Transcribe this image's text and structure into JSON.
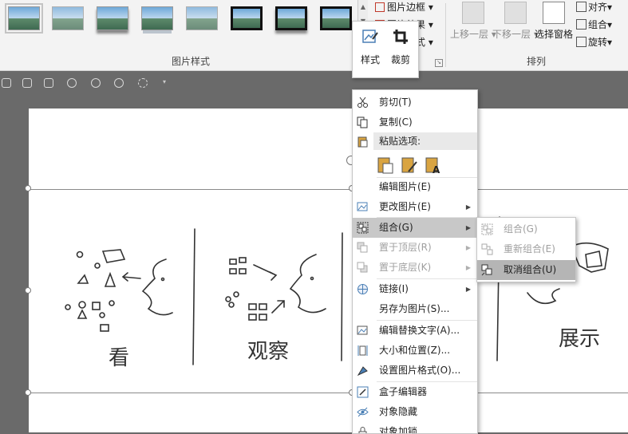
{
  "ribbon": {
    "gallery_styles": [
      "simple-frame-white",
      "soft-edge-rectangle",
      "drop-shadow-rectangle",
      "reflected-rounded",
      "soft-edge-oval",
      "double-frame-black",
      "thick-matte-black",
      "simple-frame-black"
    ],
    "picture_border": "图片边框",
    "picture_effects": "图片效果",
    "picture_layout": "图片版式",
    "picture_styles_group": "图片样式",
    "bring_forward": "上移一层",
    "send_backward": "下移一层",
    "selection_pane": "选择窗格",
    "align": "对齐",
    "group": "组合",
    "rotate": "旋转",
    "arrange_group": "排列"
  },
  "mini_toolbar": {
    "style": "样式",
    "crop": "裁剪"
  },
  "slide": {
    "label_see": "看",
    "label_observe": "观察",
    "label_show": "展示"
  },
  "context_menu": {
    "items": [
      {
        "label": "剪切(T)",
        "icon": "scissors-icon"
      },
      {
        "label": "复制(C)",
        "icon": "copy-icon"
      },
      {
        "label": "粘贴选项:",
        "icon": "clipboard-icon"
      },
      {
        "label": "编辑图片(E)"
      },
      {
        "label": "更改图片(E)",
        "icon": "change-picture-icon"
      },
      {
        "label": "组合(G)",
        "icon": "group-icon"
      },
      {
        "label": "置于顶层(R)",
        "icon": "bring-to-front-icon"
      },
      {
        "label": "置于底层(K)",
        "icon": "send-to-back-icon"
      },
      {
        "label": "链接(I)",
        "icon": "link-icon"
      },
      {
        "label": "另存为图片(S)..."
      },
      {
        "label": "编辑替换文字(A)...",
        "icon": "alt-text-icon"
      },
      {
        "label": "大小和位置(Z)...",
        "icon": "size-position-icon"
      },
      {
        "label": "设置图片格式(O)...",
        "icon": "format-picture-icon"
      },
      {
        "label": "盒子编辑器",
        "icon": "box-editor-icon"
      },
      {
        "label": "对象隐藏",
        "icon": "eye-hide-icon"
      },
      {
        "label": "对象加锁",
        "icon": "lock-icon"
      }
    ]
  },
  "submenu": {
    "items": [
      {
        "label": "组合(G)",
        "icon": "group-icon"
      },
      {
        "label": "重新组合(E)",
        "icon": "regroup-icon"
      },
      {
        "label": "取消组合(U)",
        "icon": "ungroup-icon"
      }
    ]
  }
}
